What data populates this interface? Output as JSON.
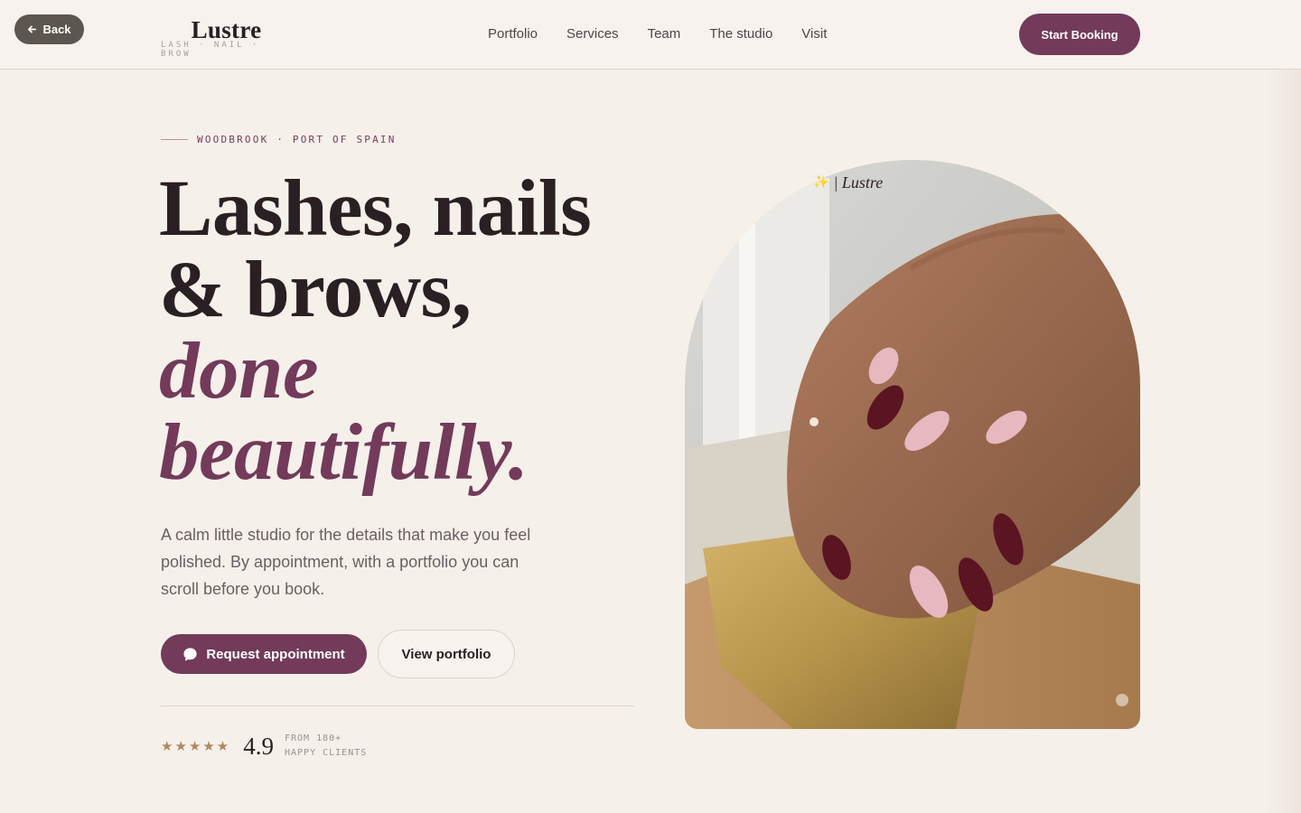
{
  "header": {
    "back_label": "Back",
    "logo_name": "Lustre",
    "logo_tagline": "LASH · NAIL · BROW",
    "nav": [
      "Portfolio",
      "Services",
      "Team",
      "The studio",
      "Visit"
    ],
    "cta_label": "Start Booking"
  },
  "hero": {
    "eyebrow": "WOODBROOK · PORT OF SPAIN",
    "headline_line1": "Lashes, nails",
    "headline_line2": "& brows,",
    "headline_accent1": "done",
    "headline_accent2": "beautifully.",
    "intro": "A calm little studio for the details that make you feel polished. By appointment, with a portfolio you can scroll before you book.",
    "primary_label": "Request appointment",
    "secondary_label": "View portfolio",
    "stars": "★★★★★",
    "rating_value": "4.9",
    "rating_caption_line1": "FROM 180+",
    "rating_caption_line2": "HAPPY CLIENTS"
  },
  "photo": {
    "watermark": "| Lustre",
    "sparkle": "✨"
  },
  "colors": {
    "accent": "#733a59",
    "background": "#f6f0eb",
    "text": "#2a1f22",
    "star": "#b08a60"
  }
}
